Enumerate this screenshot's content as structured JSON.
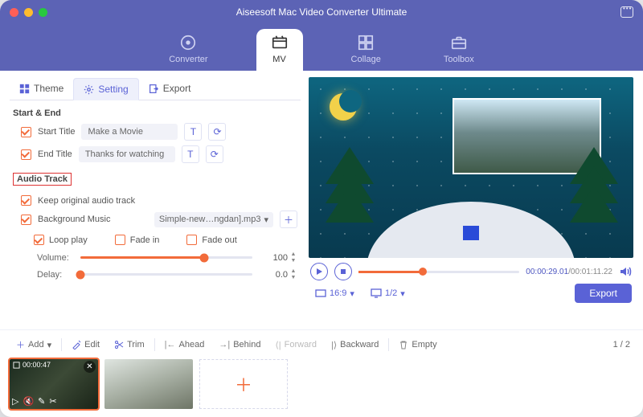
{
  "app": {
    "title": "Aiseesoft Mac Video Converter Ultimate"
  },
  "nav": {
    "converter": "Converter",
    "mv": "MV",
    "collage": "Collage",
    "toolbox": "Toolbox"
  },
  "tabs": {
    "theme": "Theme",
    "setting": "Setting",
    "export": "Export"
  },
  "settings": {
    "start_end_header": "Start & End",
    "start_title_label": "Start Title",
    "start_title_value": "Make a Movie",
    "end_title_label": "End Title",
    "end_title_value": "Thanks for watching",
    "audio_header": "Audio Track",
    "keep_original": "Keep original audio track",
    "bg_music_label": "Background Music",
    "bg_music_value": "Simple-new…ngdan].mp3",
    "loop": "Loop play",
    "fade_in": "Fade in",
    "fade_out": "Fade out",
    "volume_label": "Volume:",
    "volume_value": "100",
    "delay_label": "Delay:",
    "delay_value": "0.0"
  },
  "player": {
    "time_current": "00:00:29.01",
    "time_total": "00:01:11.22",
    "aspect": "16:9",
    "page": "1/2",
    "export": "Export"
  },
  "toolbar": {
    "add": "Add",
    "edit": "Edit",
    "trim": "Trim",
    "ahead": "Ahead",
    "behind": "Behind",
    "forward": "Forward",
    "backward": "Backward",
    "empty": "Empty",
    "page": "1 / 2"
  },
  "clip": {
    "duration": "00:00:47"
  }
}
